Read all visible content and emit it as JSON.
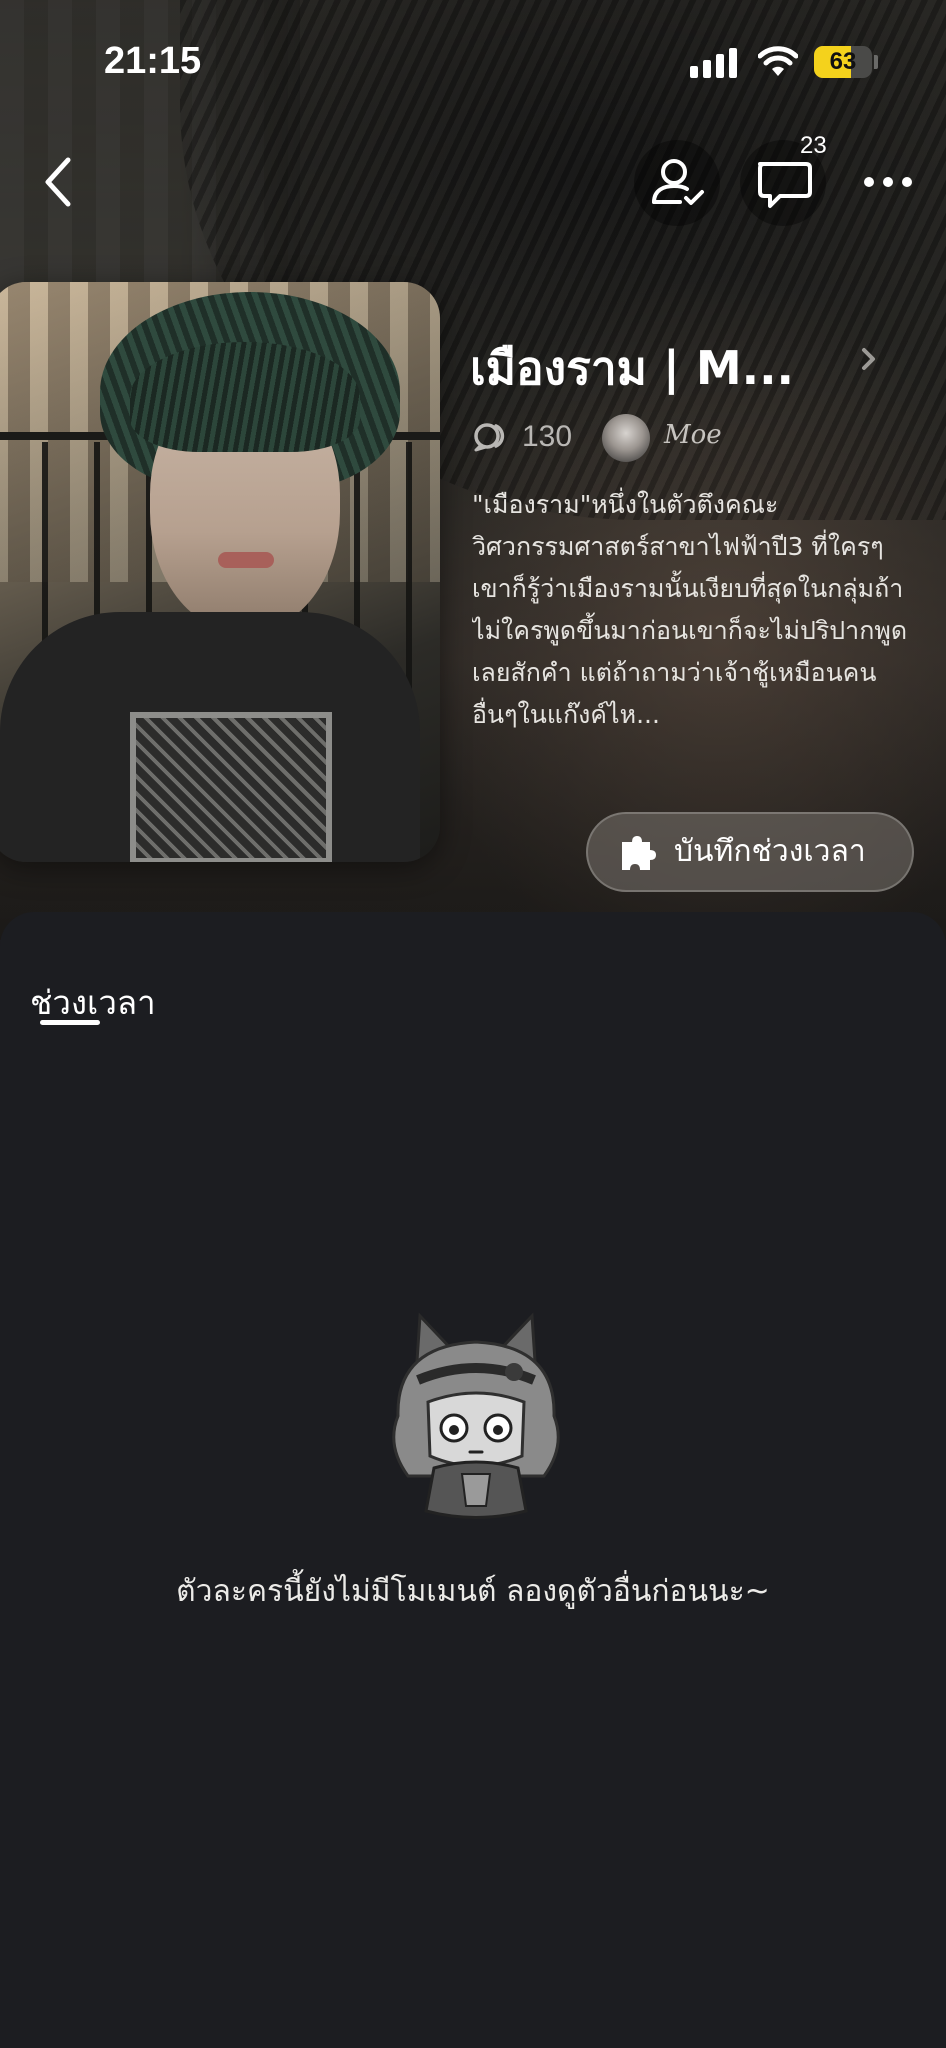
{
  "status_bar": {
    "time": "21:15",
    "battery": "63",
    "battery_level_percent": 63
  },
  "nav": {
    "back_icon": "chevron-left-icon",
    "follow_icon": "user-check-icon",
    "chat_icon": "chat-bubble-icon",
    "chat_count": "23",
    "more_icon": "more-horizontal-icon"
  },
  "character": {
    "name": "เมืองราม | M...",
    "chat_count": "130",
    "creator": "Moe",
    "description": "\"เมืองราม\"หนึ่งในตัวตึงคณะวิศวกรรมศาสตร์สาขาไฟฟ้าปี3 ที่ใครๆเขาก็รู้ว่าเมืองรามนั้นเงียบที่สุดในกลุ่มถ้าไม่ใครพูดขึ้นมาก่อนเขาก็จะไม่ปริปากพูดเลยสักคำ แต่ถ้าถามว่าเจ้าชู้เหมือนคนอื่นๆในแก๊งค์ไห..."
  },
  "actions": {
    "save_moment": "บันทึกช่วงเวลา"
  },
  "tabs": {
    "moments": "ช่วงเวลา"
  },
  "empty_state": {
    "message": "ตัวละครนี้ยังไม่มีโมเมนต์ ลองดูตัวอื่นก่อนนะ~"
  },
  "colors": {
    "background": "#1c1d21",
    "battery_accent": "#f4d21c",
    "muted_text": "#b9b7b4"
  }
}
